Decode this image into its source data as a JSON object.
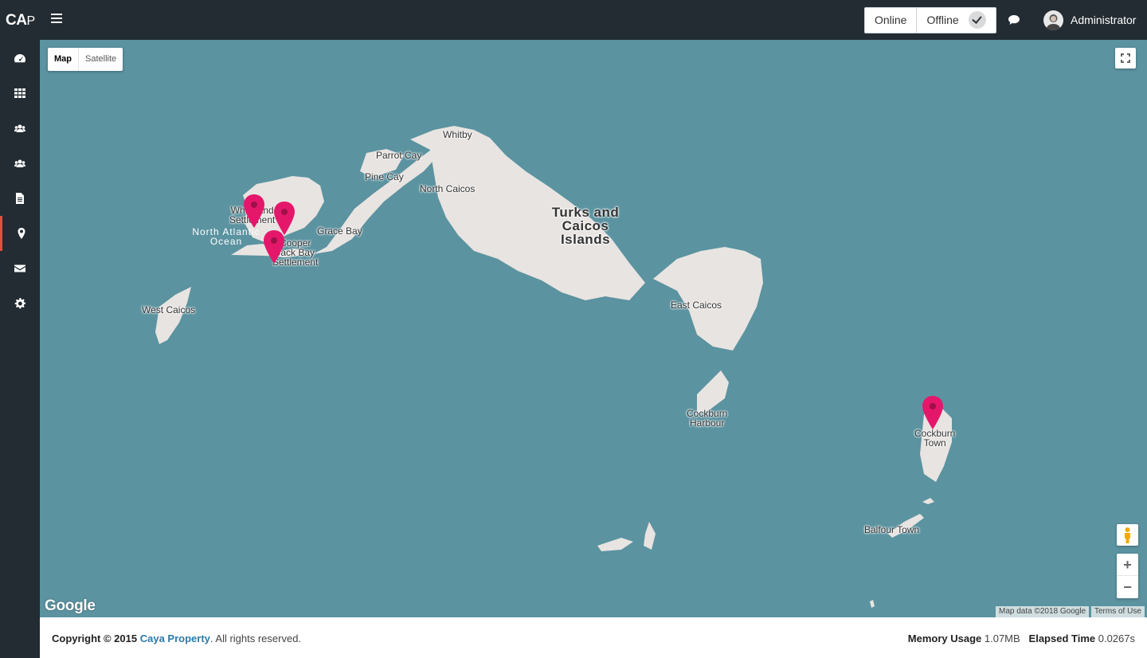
{
  "header": {
    "logo_bold": "CA",
    "logo_light": "P",
    "status_online": "Online",
    "status_offline": "Offline",
    "user_name": "Administrator"
  },
  "sidebar": {
    "items": [
      {
        "icon": "dashboard-icon"
      },
      {
        "icon": "grid-icon"
      },
      {
        "icon": "users-icon"
      },
      {
        "icon": "group-icon"
      },
      {
        "icon": "document-icon"
      },
      {
        "icon": "map-marker-icon",
        "active": true
      },
      {
        "icon": "envelope-icon"
      },
      {
        "icon": "gear-icon"
      }
    ]
  },
  "map": {
    "type_map": "Map",
    "type_satellite": "Satellite",
    "google": "Google",
    "attribution": "Map data ©2018 Google",
    "terms": "Terms of Use",
    "labels": {
      "whitby": "Whitby",
      "parrot_cay": "Parrot Cay",
      "pine_cay": "Pine Cay",
      "north_caicos": "North Caicos",
      "turks_caicos_1": "Turks and",
      "turks_caicos_2": "Caicos",
      "turks_caicos_3": "Islands",
      "grace_bay": "Grace Bay",
      "north_atlantic_1": "North Atlantic",
      "north_atlantic_2": "Ocean",
      "wheeland_1": "Wheeland",
      "wheeland_2": "Settlement",
      "cooper_1": "Cooper",
      "cooper_2": "Jack Bay",
      "cooper_3": "Settlement",
      "west_caicos": "West Caicos",
      "east_caicos": "East Caicos",
      "cockburn_harbour_1": "Cockburn",
      "cockburn_harbour_2": "Harbour",
      "cockburn_town_1": "Cockburn",
      "cockburn_town_2": "Town",
      "balfour_town": "Balfour Town"
    },
    "colors": {
      "water": "#5b93a0",
      "land": "#e8e4e1",
      "pin": "#e5176b"
    }
  },
  "footer": {
    "copyright_prefix": "Copyright © 2015",
    "company": "Caya Property",
    "rights": ". All rights reserved.",
    "memory_label": "Memory Usage",
    "memory_value": "1.07MB",
    "elapsed_label": "Elapsed Time",
    "elapsed_value": "0.0267s"
  }
}
